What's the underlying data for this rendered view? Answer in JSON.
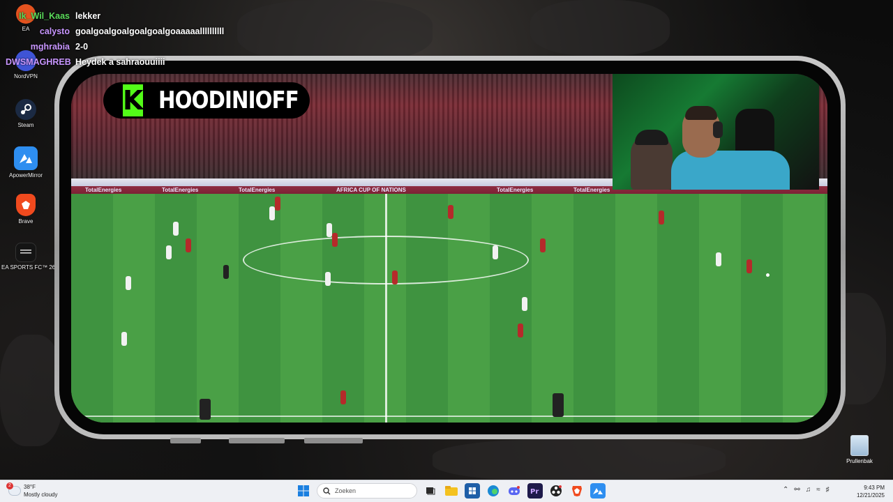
{
  "chat": [
    {
      "user": "Ik_Wil_Kaas",
      "message": "lekker",
      "color": "#5bdc5b"
    },
    {
      "user": "calysto",
      "message": "goalgoalgoalgoalgoalgoaaaaallllllllll",
      "color": "#c896ff"
    },
    {
      "user": "mghrabia",
      "message": "2-0",
      "color": "#c896ff"
    },
    {
      "user": "DWSMAGHREB",
      "message": "Heydek a sahraouuiiii",
      "color": "#c896ff"
    }
  ],
  "desktop_icons": [
    {
      "label": "EA",
      "icon": "ea-icon"
    },
    {
      "label": "NordVPN",
      "icon": "nordvpn-icon"
    },
    {
      "label": "Steam",
      "icon": "steam-icon"
    },
    {
      "label": "ApowerMirror",
      "icon": "apowermirror-icon"
    },
    {
      "label": "Brave",
      "icon": "brave-icon"
    },
    {
      "label": "EA SPORTS FC™ 26",
      "icon": "ea-sports-fc-icon"
    }
  ],
  "stream": {
    "channel_name": "HOODINIOFF",
    "logo_letter": "K",
    "ad_texts": [
      "TotalEnergies",
      "TotalEnergies",
      "TotalEnergies",
      "AFRICA CUP OF NATIONS",
      "TotalEnergies",
      "TotalEnergies"
    ]
  },
  "recycle_bin": {
    "label": "Prullenbak"
  },
  "taskbar": {
    "weather_temp": "38°F",
    "weather_desc": "Mostly cloudy",
    "weather_badge": "2",
    "search_placeholder": "Zoeken",
    "time": "9:43 PM",
    "date": "12/21/2025"
  },
  "colors": {
    "kick_green": "#53fc18",
    "taskbar_bg": "#eef0f4"
  }
}
